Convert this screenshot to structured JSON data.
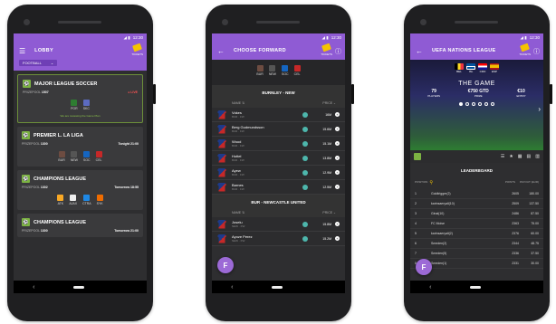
{
  "colors": {
    "accent": "#8f5bd4",
    "dark": "#2e2e30",
    "live": "#ff5252",
    "green": "#7cb342"
  },
  "phone1": {
    "status_time": "12:30",
    "title": "LOBBY",
    "tickets_label": "TICKETS",
    "filter": "FOOTBALL",
    "cards": [
      {
        "title": "MAJOR LEAGUE SOCCER",
        "prize_label": "PRIZEPOOL",
        "prize": "1507",
        "right": "● LIVE",
        "teams": [
          "POR",
          "SKC"
        ],
        "note": "We are reviewing the Game Plan"
      },
      {
        "title": "PREMIER L. LA LIGA",
        "prize_label": "PRIZEPOOL",
        "prize": "1300",
        "right": "Tonight 21:00",
        "teams": [
          "BUR",
          "NEW",
          "SOC",
          "CEL"
        ]
      },
      {
        "title": "CHAMPIONS LEAGUE",
        "prize_label": "PRIZEPOOL",
        "prize": "1302",
        "right": "Tomorrow 18:55",
        "teams": [
          "ATK",
          "AJAX",
          "CTRA",
          "SYK"
        ]
      },
      {
        "title": "CHAMPIONS LEAGUE",
        "prize_label": "PRIZEPOOL",
        "prize": "1300",
        "right": "Tomorrow 21:00"
      }
    ]
  },
  "phone2": {
    "status_time": "12:30",
    "title": "CHOOSE FORWARD",
    "tickets_label": "TICKETS",
    "clubs": [
      "BUR",
      "NEW",
      "SOC",
      "CEL"
    ],
    "section1": "BURNLEY - NEW",
    "col_name": "NAME ⇅",
    "col_price": "PRICE ⌄",
    "players1": [
      {
        "name": "Vokes",
        "pos": "BUR · FW",
        "price": "16M"
      },
      {
        "name": "Berg Gudmundsson",
        "pos": "BUR · FW",
        "price": "15.6M"
      },
      {
        "name": "Wood",
        "pos": "BUR · FW",
        "price": "15.1M"
      },
      {
        "name": "Hottel",
        "pos": "BUR · FW",
        "price": "13.8M"
      },
      {
        "name": "Ayew",
        "pos": "BUR · FW",
        "price": "12.9M"
      },
      {
        "name": "Barnes",
        "pos": "BUR · FW",
        "price": "12.5M"
      }
    ],
    "section2": "BUR - NEWCASTLE UNITED",
    "players2": [
      {
        "name": "Joselu",
        "pos": "NEW · FW",
        "price": "15.8M"
      },
      {
        "name": "Ayoze Perez",
        "pos": "NEW · FW",
        "price": "15.2M"
      }
    ],
    "fab": "F"
  },
  "phone3": {
    "status_time": "12:30",
    "title": "UEFA NATIONS LEAGUE",
    "tickets_label": "TICKETS",
    "flag_labels": [
      "BEL",
      "ISL",
      "CRO",
      "ESP"
    ],
    "game_title": "THE GAME",
    "stats": [
      {
        "v": "79",
        "l": "PLAYERS"
      },
      {
        "v": "€750 GTD",
        "l": "PRIZE"
      },
      {
        "v": "€10",
        "l": "ENTRY"
      }
    ],
    "leaderboard_title": "LEADERBOARD",
    "columns": {
      "pos": "POSITION",
      "points": "POINTS",
      "payout": "PAYOUT (EUR)"
    },
    "rows": [
      {
        "pos": "1",
        "name": "Goldtrigger(2)",
        "points": "2605",
        "payout": "180.00"
      },
      {
        "pos": "2",
        "name": "karinsaeryall(10)",
        "points": "2509",
        "payout": "137.50"
      },
      {
        "pos": "3",
        "name": "Ginai(10)",
        "points": "2486",
        "payout": "87.50"
      },
      {
        "pos": "4",
        "name": "FC Moise",
        "points": "2363",
        "payout": "75.00"
      },
      {
        "pos": "5",
        "name": "karinsaeryall(2)",
        "points": "2376",
        "payout": "60.00"
      },
      {
        "pos": "6",
        "name": "Smeden(2)",
        "points": "2344",
        "payout": "48.75"
      },
      {
        "pos": "7",
        "name": "Smeden(5)",
        "points": "2336",
        "payout": "37.50"
      },
      {
        "pos": "8",
        "name": "Smeden(1)",
        "points": "2331",
        "payout": "30.00"
      }
    ],
    "fab": "F"
  }
}
